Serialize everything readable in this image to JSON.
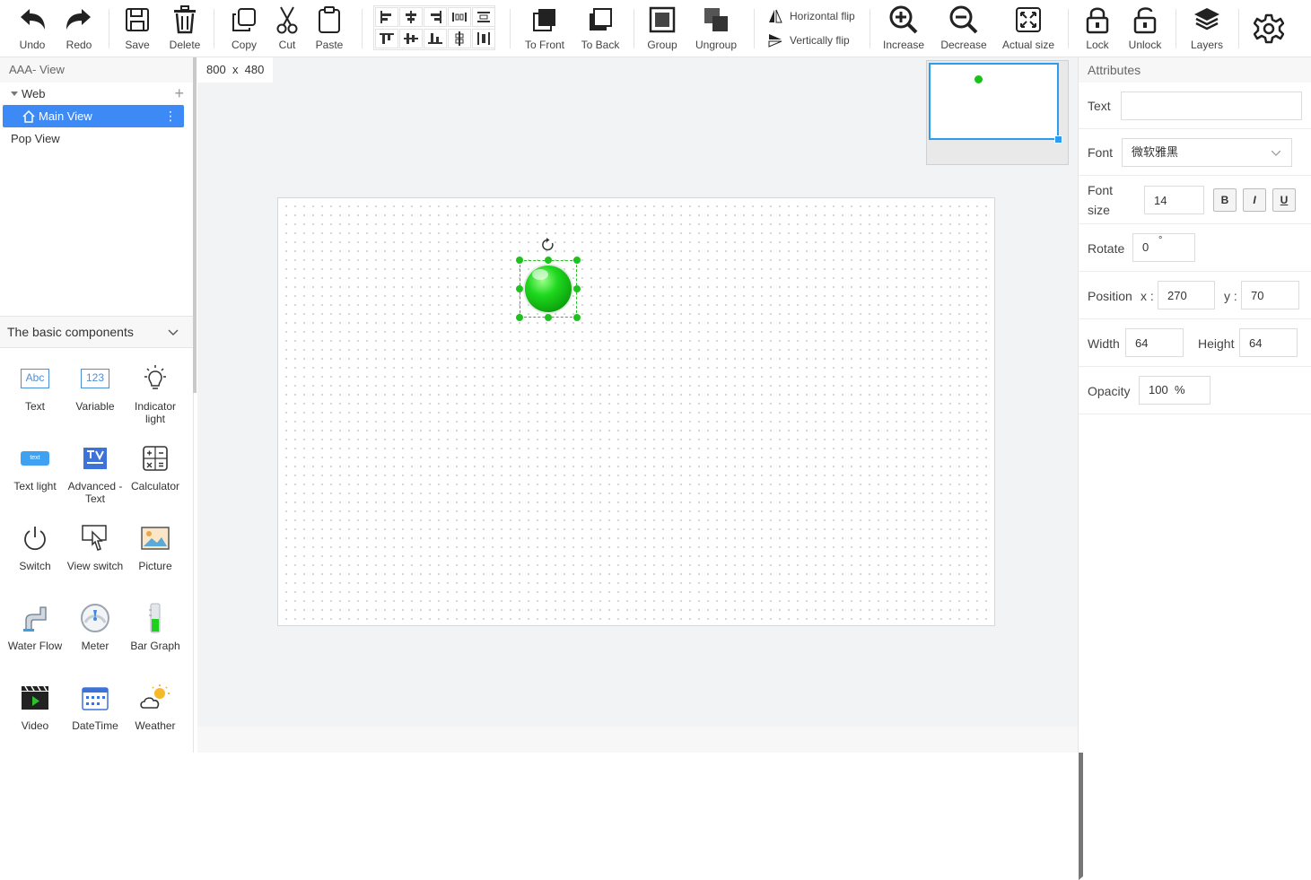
{
  "toolbar": {
    "undo": "Undo",
    "redo": "Redo",
    "save": "Save",
    "delete": "Delete",
    "copy": "Copy",
    "cut": "Cut",
    "paste": "Paste",
    "to_front": "To Front",
    "to_back": "To Back",
    "group": "Group",
    "ungroup": "Ungroup",
    "horizontal_flip": "Horizontal flip",
    "vertically_flip": "Vertically flip",
    "increase": "Increase",
    "decrease": "Decrease",
    "actual_size": "Actual size",
    "lock": "Lock",
    "unlock": "Unlock",
    "layers": "Layers"
  },
  "project": {
    "title": "AAA- View",
    "tree": {
      "root": "Web",
      "selected": "Main View",
      "other": "Pop View"
    }
  },
  "components": {
    "header": "The basic components",
    "items": [
      "Text",
      "Variable",
      "Indicator light",
      "Text light",
      "Advanced - Text",
      "Calculator",
      "Switch",
      "View switch",
      "Picture",
      "Water Flow",
      "Meter",
      "Bar Graph",
      "Video",
      "DateTime",
      "Weather"
    ],
    "icon_texts": {
      "text": "Abc",
      "variable": "123",
      "text_light": "text"
    }
  },
  "canvas": {
    "size_w": "800",
    "size_x": "x",
    "size_h": "480"
  },
  "attributes": {
    "header": "Attributes",
    "text_label": "Text",
    "text_value": "",
    "font_label": "Font",
    "font_value": "微软雅黑",
    "font_size_label_1": "Font",
    "font_size_label_2": "size",
    "font_size_value": "14",
    "bold": "B",
    "italic": "I",
    "underline": "U",
    "rotate_label": "Rotate",
    "rotate_value": "0",
    "rotate_unit": "°",
    "position_label": "Position",
    "x_label": "x :",
    "x_value": "270",
    "y_label": "y :",
    "y_value": "70",
    "width_label": "Width",
    "width_value": "64",
    "height_label": "Height",
    "height_value": "64",
    "opacity_label": "Opacity",
    "opacity_value": "100",
    "opacity_unit": "%"
  },
  "colors": {
    "accent": "#3d8af7",
    "indicator": "#19c219",
    "minimap_border": "#2c9cf0"
  }
}
